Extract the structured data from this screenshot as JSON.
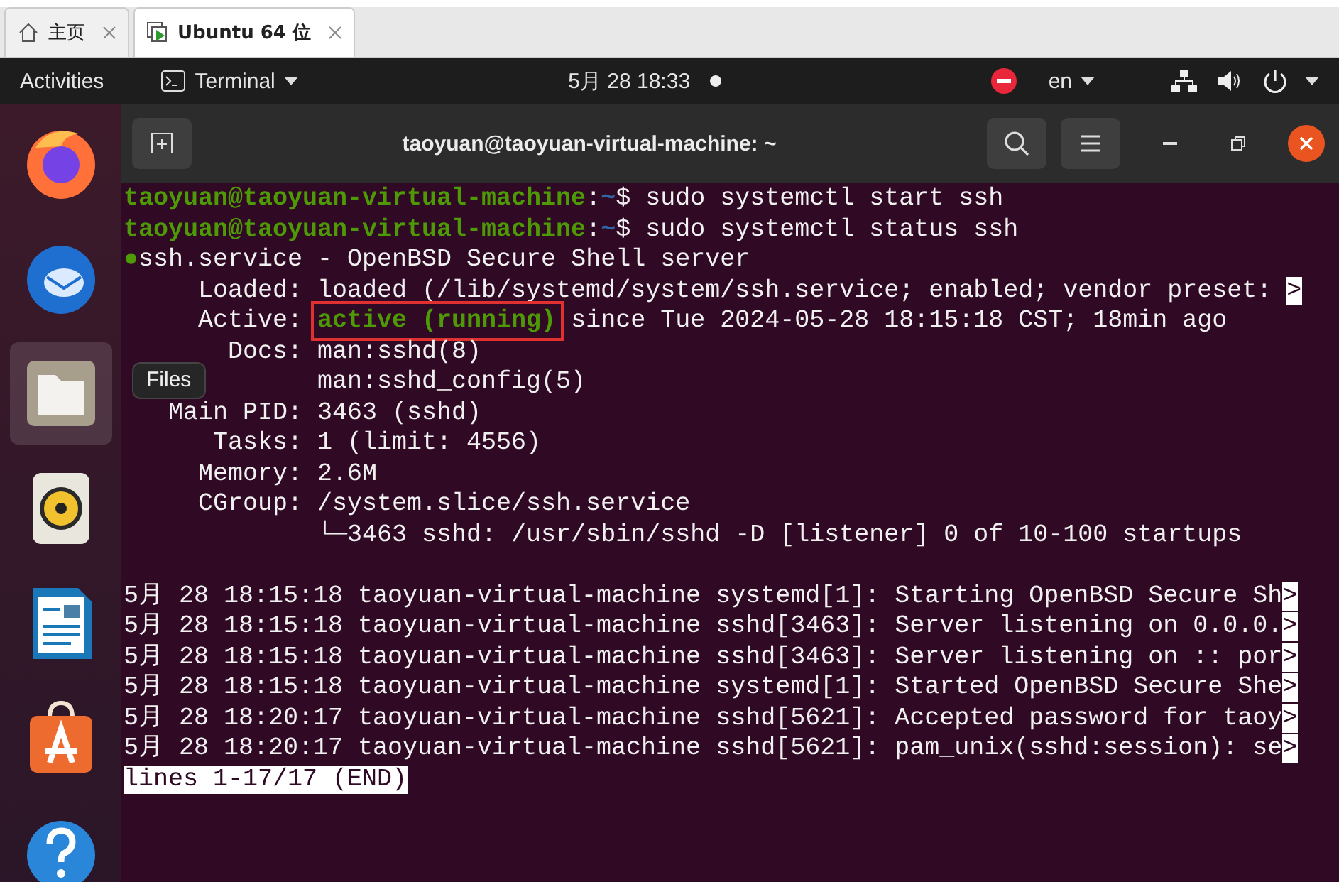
{
  "browser_tabs": [
    {
      "label": "主页",
      "selected": false
    },
    {
      "label": "Ubuntu 64 位",
      "selected": true
    }
  ],
  "top_bar": {
    "activities": "Activities",
    "app_menu": "Terminal",
    "clock": "5月 28  18:33",
    "language": "en"
  },
  "dock": {
    "items": [
      {
        "kind": "firefox",
        "selected": false
      },
      {
        "kind": "thunderbird",
        "selected": false
      },
      {
        "kind": "files",
        "selected": true
      },
      {
        "kind": "rhythmbox",
        "selected": false
      },
      {
        "kind": "writer",
        "selected": false
      },
      {
        "kind": "software",
        "selected": false
      },
      {
        "kind": "help",
        "selected": false
      }
    ],
    "tooltip": "Files"
  },
  "terminal": {
    "title": "taoyuan@taoyuan-virtual-machine: ~",
    "lines": [
      [
        {
          "kind": "user",
          "text": "taoyuan@taoyuan-virtual-machine"
        },
        {
          "kind": "plain",
          "text": ":"
        },
        {
          "kind": "path",
          "text": "~"
        },
        {
          "kind": "plain",
          "text": "$ sudo systemctl start ssh"
        }
      ],
      [
        {
          "kind": "user",
          "text": "taoyuan@taoyuan-virtual-machine"
        },
        {
          "kind": "plain",
          "text": ":"
        },
        {
          "kind": "path",
          "text": "~"
        },
        {
          "kind": "plain",
          "text": "$ sudo systemctl status ssh"
        }
      ],
      [
        {
          "kind": "ok",
          "text": "●"
        },
        {
          "kind": "plain",
          "text": "ssh.service - OpenBSD Secure Shell server"
        }
      ],
      [
        {
          "kind": "plain",
          "text": "     Loaded: loaded (/lib/systemd/system/ssh.service; enabled; vendor preset: "
        },
        {
          "kind": "inverse",
          "text": ">"
        }
      ],
      [
        {
          "kind": "plain",
          "text": "     Active: "
        },
        {
          "kind": "ok",
          "text": "active (running)",
          "boxed": true
        },
        {
          "kind": "plain",
          "text": " since Tue 2024-05-28 18:15:18 CST; 18min ago"
        }
      ],
      [
        {
          "kind": "plain",
          "text": "       Docs: man:sshd(8)"
        }
      ],
      [
        {
          "kind": "plain",
          "text": "             man:sshd_config(5)"
        }
      ],
      [
        {
          "kind": "plain",
          "text": "   Main PID: 3463 (sshd)"
        }
      ],
      [
        {
          "kind": "plain",
          "text": "      Tasks: 1 (limit: 4556)"
        }
      ],
      [
        {
          "kind": "plain",
          "text": "     Memory: 2.6M"
        }
      ],
      [
        {
          "kind": "plain",
          "text": "     CGroup: /system.slice/ssh.service"
        }
      ],
      [
        {
          "kind": "plain",
          "text": "             └─3463 sshd: /usr/sbin/sshd -D [listener] 0 of 10-100 startups"
        }
      ]
    ],
    "journal_lines": [
      [
        {
          "kind": "plain",
          "text": "5月 28 18:15:18 taoyuan-virtual-machine systemd[1]: Starting OpenBSD Secure Sh"
        },
        {
          "kind": "inverse",
          "text": ">"
        }
      ],
      [
        {
          "kind": "plain",
          "text": "5月 28 18:15:18 taoyuan-virtual-machine sshd[3463]: Server listening on 0.0.0."
        },
        {
          "kind": "inverse",
          "text": ">"
        }
      ],
      [
        {
          "kind": "plain",
          "text": "5月 28 18:15:18 taoyuan-virtual-machine sshd[3463]: Server listening on :: por"
        },
        {
          "kind": "inverse",
          "text": ">"
        }
      ],
      [
        {
          "kind": "plain",
          "text": "5月 28 18:15:18 taoyuan-virtual-machine systemd[1]: Started OpenBSD Secure She"
        },
        {
          "kind": "inverse",
          "text": ">"
        }
      ],
      [
        {
          "kind": "plain",
          "text": "5月 28 18:20:17 taoyuan-virtual-machine sshd[5621]: Accepted password for taoy"
        },
        {
          "kind": "inverse",
          "text": ">"
        }
      ],
      [
        {
          "kind": "plain",
          "text": "5月 28 18:20:17 taoyuan-virtual-machine sshd[5621]: pam_unix(sshd:session): se"
        },
        {
          "kind": "inverse",
          "text": ">"
        }
      ],
      [
        {
          "kind": "inverse",
          "text": "lines 1-17/17 (END)"
        }
      ]
    ]
  }
}
